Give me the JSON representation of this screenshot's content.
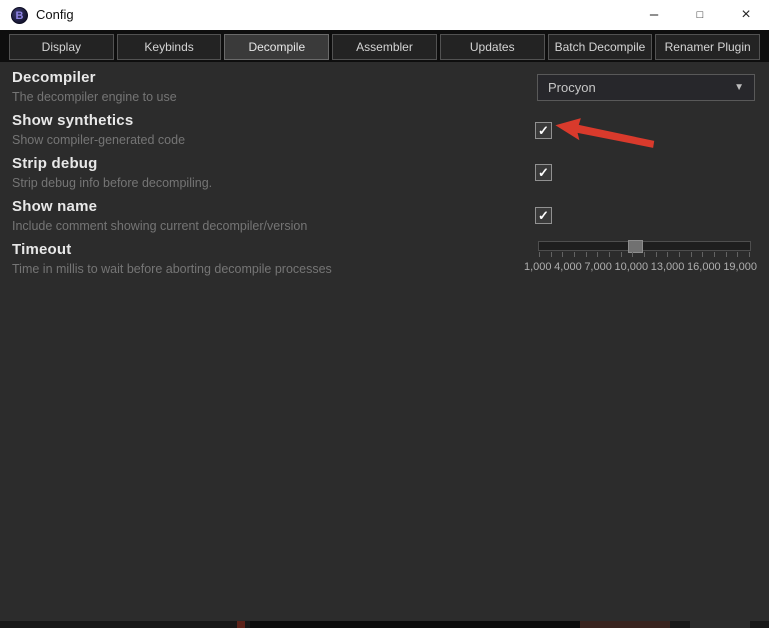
{
  "window": {
    "title": "Config",
    "icon_letter": "B"
  },
  "titlebar_controls": {
    "minimize": "–",
    "maximize": "□",
    "close": "×"
  },
  "tabs": [
    {
      "label": "Display",
      "active": false
    },
    {
      "label": "Keybinds",
      "active": false
    },
    {
      "label": "Decompile",
      "active": true
    },
    {
      "label": "Assembler",
      "active": false
    },
    {
      "label": "Updates",
      "active": false
    },
    {
      "label": "Batch Decompile",
      "active": false
    },
    {
      "label": "Renamer Plugin",
      "active": false
    }
  ],
  "settings": {
    "decompiler": {
      "name": "Decompiler",
      "description": "The decompiler engine to use",
      "value": "Procyon"
    },
    "show_synthetics": {
      "name": "Show synthetics",
      "description": "Show compiler-generated code",
      "checked": true,
      "annotated": true
    },
    "strip_debug": {
      "name": "Strip debug",
      "description": "Strip debug info before decompiling.",
      "checked": true
    },
    "show_name": {
      "name": "Show name",
      "description": "Include comment showing current decompiler/version",
      "checked": true
    },
    "timeout": {
      "name": "Timeout",
      "description": "Time in millis to wait before aborting decompile processes",
      "tick_labels": [
        "1,000",
        "4,000",
        "7,000",
        "10,000",
        "13,000",
        "16,000",
        "19,000"
      ],
      "thumb_position_pct": 42
    }
  },
  "icons": {
    "checkmark": "✓",
    "dropdown_arrow": "▼"
  },
  "colors": {
    "annotation_red": "#d93a2c",
    "titlebar_bg": "#ffffff",
    "content_bg": "#2c2c2c"
  }
}
